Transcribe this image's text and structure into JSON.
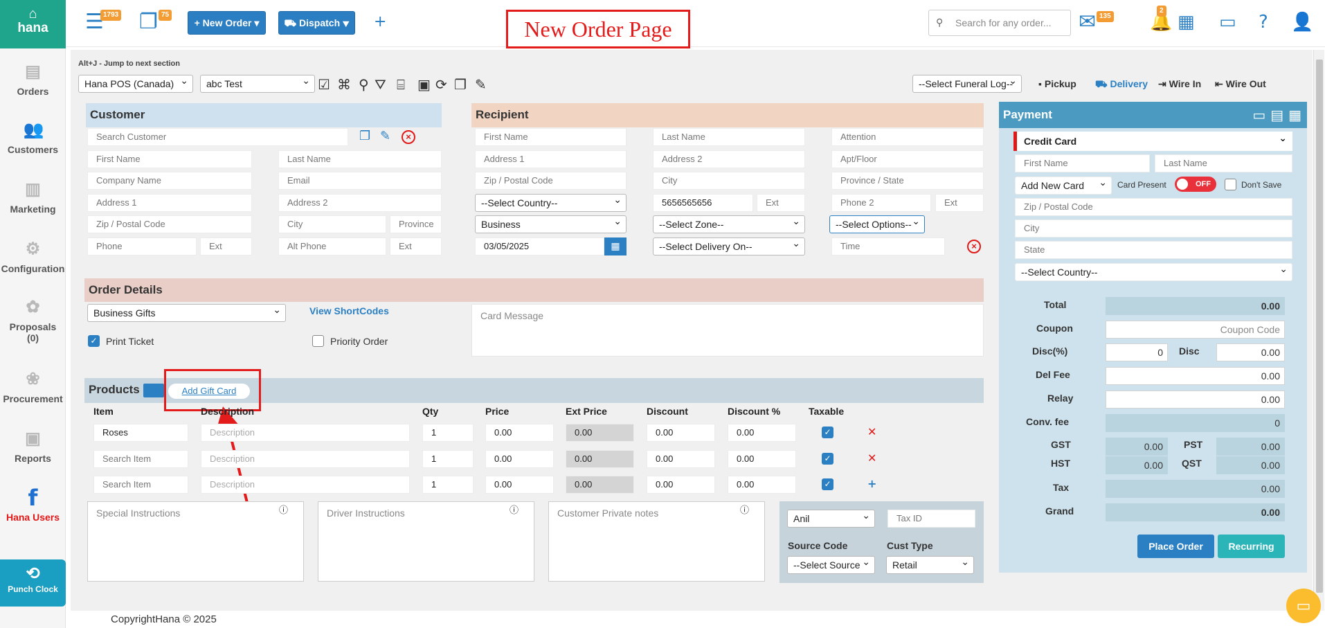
{
  "brand": {
    "name": "hana"
  },
  "sidebar": {
    "items": [
      {
        "label": "Orders",
        "icon": "orders-icon"
      },
      {
        "label": "Customers",
        "icon": "customers-icon"
      },
      {
        "label": "Marketing",
        "icon": "marketing-icon"
      },
      {
        "label": "Configuration",
        "icon": "gear-icon"
      },
      {
        "label": "Proposals",
        "sub": "(0)",
        "icon": "proposals-icon"
      },
      {
        "label": "Procurement",
        "icon": "procurement-icon"
      },
      {
        "label": "Reports",
        "icon": "reports-icon"
      },
      {
        "label": "Hana Users",
        "icon": "facebook-icon"
      }
    ],
    "punch_clock": "Punch Clock"
  },
  "topbar": {
    "badge_orders": "1793",
    "badge_pages": "75",
    "new_order": "New Order",
    "dispatch": "Dispatch",
    "annotation": "New Order Page",
    "search_placeholder": "Search for any order...",
    "badge_mail": "135",
    "badge_bell": "2"
  },
  "toolbar": {
    "hint": "Alt+J - Jump to next section",
    "store": "Hana POS (Canada)",
    "user": "abc Test",
    "funeral_log": "--Select Funeral Log--",
    "modes": [
      "Pickup",
      "Delivery",
      "Wire In",
      "Wire Out"
    ]
  },
  "customer": {
    "title": "Customer",
    "search": "Search Customer",
    "first_name": "First Name",
    "last_name": "Last Name",
    "company": "Company Name",
    "email": "Email",
    "address1": "Address 1",
    "address2": "Address 2",
    "zip": "Zip / Postal Code",
    "city": "City",
    "province": "Province",
    "phone": "Phone",
    "ext": "Ext",
    "alt_phone": "Alt Phone",
    "alt_ext": "Ext"
  },
  "recipient": {
    "title": "Recipient",
    "first_name": "First Name",
    "last_name": "Last Name",
    "attention": "Attention",
    "address1": "Address 1",
    "address2": "Address 2",
    "apt": "Apt/Floor",
    "zip": "Zip / Postal Code",
    "city": "City",
    "province": "Province / State",
    "country": "--Select Country--",
    "phone": "5656565656",
    "ext": "Ext",
    "phone2": "Phone 2",
    "ext2": "Ext",
    "location_type": "Business",
    "zone": "--Select Zone--",
    "options": "--Select Options--",
    "date": "03/05/2025",
    "delivery_on": "--Select Delivery On--",
    "time": "Time"
  },
  "order_details": {
    "title": "Order Details",
    "occasion": "Business Gifts",
    "shortcodes": "View ShortCodes",
    "card_message": "Card Message",
    "print_ticket": "Print Ticket",
    "priority_order": "Priority Order"
  },
  "products": {
    "title": "Products",
    "add_gift_card": "Add Gift Card",
    "columns": [
      "Item",
      "Description",
      "Qty",
      "Price",
      "Ext Price",
      "Discount",
      "Discount %",
      "Taxable"
    ],
    "rows": [
      {
        "item": "Roses",
        "description": "Description",
        "qty": "1",
        "price": "0.00",
        "ext_price": "0.00",
        "discount": "0.00",
        "discount_pct": "0.00"
      },
      {
        "item": "Search Item",
        "description": "Description",
        "qty": "1",
        "price": "0.00",
        "ext_price": "0.00",
        "discount": "0.00",
        "discount_pct": "0.00"
      },
      {
        "item": "Search Item",
        "description": "Description",
        "qty": "1",
        "price": "0.00",
        "ext_price": "0.00",
        "discount": "0.00",
        "discount_pct": "0.00"
      }
    ],
    "special_instructions": "Special Instructions",
    "driver_instructions": "Driver Instructions",
    "private_notes": "Customer Private notes",
    "salesperson": "Anil",
    "tax_id": "Tax ID",
    "source_code_label": "Source Code",
    "source_code": "--Select Source",
    "cust_type_label": "Cust Type",
    "cust_type": "Retail"
  },
  "payment": {
    "title": "Payment",
    "method": "Credit Card",
    "first_name": "First Name",
    "last_name": "Last Name",
    "card_select": "Add New Card",
    "card_present": "Card Present",
    "toggle": "OFF",
    "dont_save": "Don't Save",
    "zip": "Zip / Postal Code",
    "city": "City",
    "state": "State",
    "country": "--Select Country--",
    "total_label": "Total",
    "total": "0.00",
    "coupon_label": "Coupon",
    "coupon": "Coupon Code",
    "disc_pct_label": "Disc(%)",
    "disc_pct": "0",
    "disc_label": "Disc",
    "disc": "0.00",
    "del_fee_label": "Del Fee",
    "del_fee": "0.00",
    "relay_label": "Relay",
    "relay": "0.00",
    "conv_fee_label": "Conv. fee",
    "conv_fee": "0",
    "gst_label": "GST",
    "gst": "0.00",
    "pst_label": "PST",
    "pst": "0.00",
    "hst_label": "HST",
    "hst": "0.00",
    "qst_label": "QST",
    "qst": "0.00",
    "tax_label": "Tax",
    "tax": "0.00",
    "grand_label": "Grand",
    "grand": "0.00",
    "place_order": "Place Order",
    "recurring": "Recurring"
  },
  "footer": {
    "copyright": "CopyrightHana © 2025"
  },
  "colors": {
    "brand": "#1fa58b",
    "primary": "#2b7ec1",
    "annotation": "#e31b1b",
    "badge": "#f39c33"
  }
}
